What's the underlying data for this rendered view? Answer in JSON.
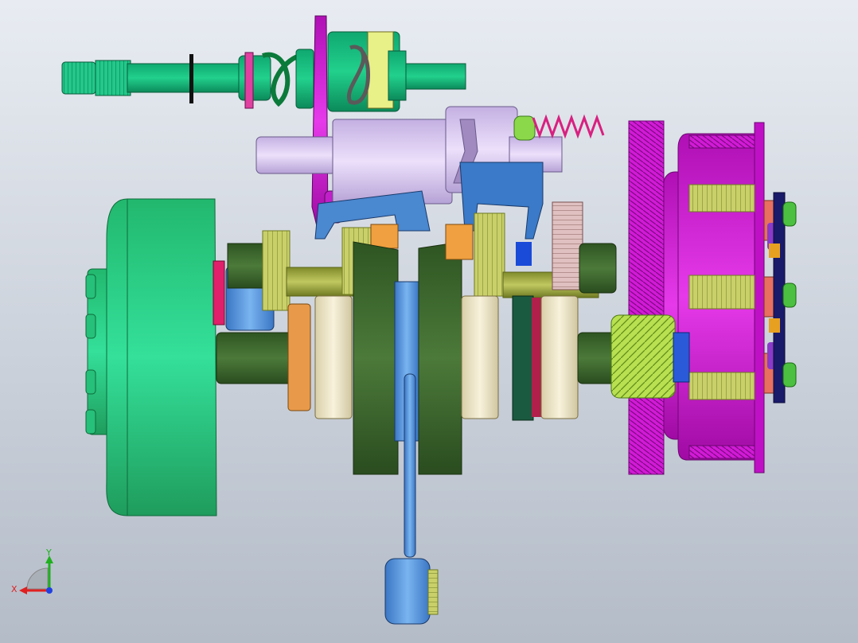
{
  "view": {
    "background_top": "#e8ecf2",
    "background_bottom": "#b4bcc8"
  },
  "triad": {
    "x_label": "X",
    "y_label": "Y",
    "x_color": "#e02020",
    "y_color": "#20b020",
    "z_color": "#2040e0"
  },
  "palette": {
    "green": "#2fd08a",
    "dark_green": "#3e6b2f",
    "olive": "#9aa83c",
    "yellow_green": "#c8e07a",
    "magenta": "#d21ad6",
    "lavender": "#d9c8f0",
    "blue": "#4a8ad8",
    "cream": "#f2ead0",
    "orange": "#f0a040"
  }
}
